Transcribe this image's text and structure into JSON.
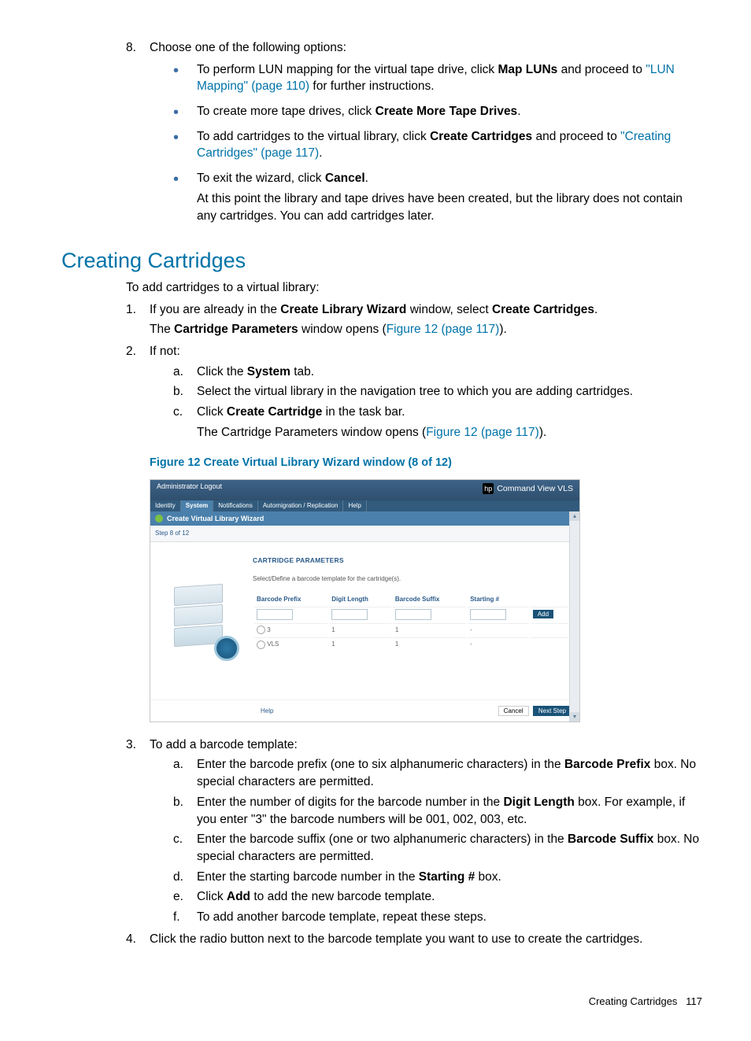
{
  "step8": {
    "num": "8.",
    "lead": "Choose one of the following options:",
    "b1a": "To perform LUN mapping for the virtual tape drive, click ",
    "b1b": "Map LUNs",
    "b1c": " and proceed to ",
    "b1link": "\"LUN Mapping\" (page 110)",
    "b1d": " for further instructions.",
    "b2a": "To create more tape drives, click ",
    "b2b": "Create More Tape Drives",
    "b2c": ".",
    "b3a": "To add cartridges to the virtual library, click ",
    "b3b": "Create Cartridges",
    "b3c": " and proceed to ",
    "b3link": "\"Creating Cartridges\" (page 117)",
    "b3d": ".",
    "b4a": "To exit the wizard, click ",
    "b4b": "Cancel",
    "b4c": ".",
    "b4sub": "At this point the library and tape drives have been created, but the library does not contain any cartridges. You can add cartridges later."
  },
  "heading": "Creating Cartridges",
  "intro": "To add cartridges to a virtual library:",
  "s1": {
    "num": "1.",
    "a": "If you are already in the ",
    "b": "Create Library Wizard",
    "c": " window, select ",
    "d": "Create Cartridges",
    "e": ".",
    "l2a": "The ",
    "l2b": "Cartridge Parameters",
    "l2c": " window opens (",
    "l2link": "Figure 12 (page 117)",
    "l2d": ")."
  },
  "s2": {
    "num": "2.",
    "lead": "If not:",
    "a_n": "a.",
    "a1": "Click the ",
    "a2": "System",
    "a3": " tab.",
    "b_n": "b.",
    "b1": "Select the virtual library in the navigation tree to which you are adding cartridges.",
    "c_n": "c.",
    "c1": "Click ",
    "c2": "Create Cartridge",
    "c3": " in the task bar.",
    "csub_a": "The Cartridge Parameters window opens (",
    "csub_link": "Figure 12 (page 117)",
    "csub_b": ")."
  },
  "figcap": "Figure 12 Create Virtual Library Wizard window (8 of 12)",
  "shot": {
    "logout": "Administrator  Logout",
    "brand": "Command View VLS",
    "tabs": [
      "Identity",
      "System",
      "Notifications",
      "Automigration / Replication",
      "Help"
    ],
    "wtitle": "Create Virtual Library Wizard",
    "step": "Step 8 of 12",
    "ph": "CARTRIDGE PARAMETERS",
    "pdesc": "Select/Define a barcode template for the cartridge(s).",
    "cols": [
      "Barcode Prefix",
      "Digit Length",
      "Barcode Suffix",
      "Starting #"
    ],
    "add": "Add",
    "rows": [
      {
        "p": "3",
        "d": "1",
        "s": "1",
        "n": "-"
      },
      {
        "p": "VLS",
        "d": "1",
        "s": "1",
        "n": "-"
      }
    ],
    "help": "Help",
    "cancel": "Cancel",
    "next": "Next Step"
  },
  "s3": {
    "num": "3.",
    "lead": "To add a barcode template:",
    "a_n": "a.",
    "a1": "Enter the barcode prefix (one to six alphanumeric characters) in the ",
    "a2": "Barcode Prefix",
    "a3": " box. No special characters are permitted.",
    "b_n": "b.",
    "b1": "Enter the number of digits for the barcode number in the ",
    "b2": "Digit Length",
    "b3": " box. For example, if you enter \"3\" the barcode numbers will be 001, 002, 003, etc.",
    "c_n": "c.",
    "c1": "Enter the barcode suffix (one or two alphanumeric characters) in the ",
    "c2": "Barcode Suffix",
    "c3": " box. No special characters are permitted.",
    "d_n": "d.",
    "d1": "Enter the starting barcode number in the ",
    "d2": "Starting #",
    "d3": "  box.",
    "e_n": "e.",
    "e1": "Click ",
    "e2": "Add",
    "e3": " to add the new barcode template.",
    "f_n": "f.",
    "f1": "To add another barcode template, repeat these steps."
  },
  "s4": {
    "num": "4.",
    "t": "Click the radio button next to the barcode template you want to use to create the cartridges."
  },
  "footer_a": "Creating Cartridges",
  "footer_b": "117"
}
